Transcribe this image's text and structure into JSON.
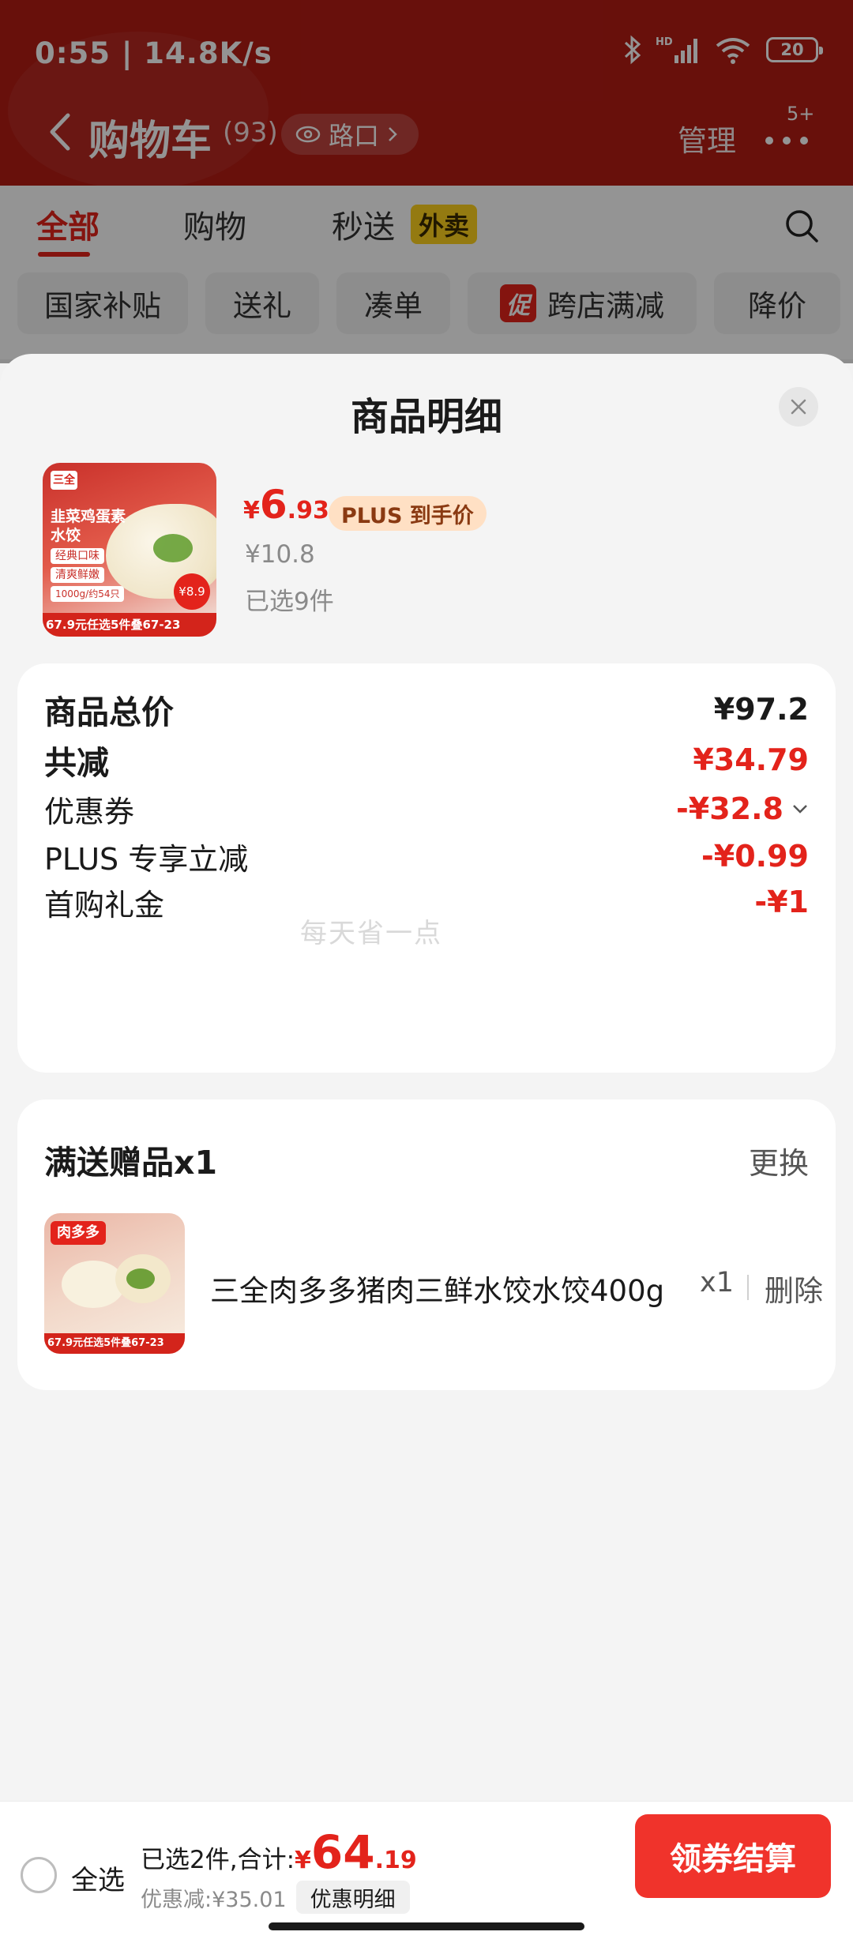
{
  "status_bar": {
    "time": "0:55 | 14.8K/s",
    "battery": "20",
    "network_badge": "HD",
    "icons": [
      "bluetooth-icon",
      "signal-icon",
      "wifi-icon",
      "battery-icon"
    ]
  },
  "header": {
    "title": "购物车",
    "count": "(93)",
    "location": "路口",
    "manage": "管理",
    "message_badge": "5+"
  },
  "tabs": [
    {
      "label": "全部",
      "active": true
    },
    {
      "label": "购物",
      "active": false
    },
    {
      "label": "秒送",
      "active": false
    }
  ],
  "tab_tag": "外卖",
  "filter_chips": [
    {
      "label": "国家补贴"
    },
    {
      "label": "送礼"
    },
    {
      "label": "凑单"
    },
    {
      "label": "跨店满减",
      "badge": "促"
    },
    {
      "label": "降价"
    }
  ],
  "sheet": {
    "title": "商品明细",
    "product": {
      "thumb": {
        "brand": "三全",
        "title": "韭菜鸡蛋素水饺",
        "tags": [
          "经典口味",
          "清爽鲜嫩",
          "1000g/约54只"
        ],
        "promo": "67.9元任选5件叠67-23",
        "price_badge": "¥8.9"
      },
      "price_symbol": "¥",
      "price_int": "6",
      "price_dec": ".93",
      "plus_label": "PLUS 到手价",
      "original_price": "¥10.8",
      "selected": "已选9件"
    },
    "breakdown": {
      "total_label": "商品总价",
      "total_value": "¥97.2",
      "saved_label": "共减",
      "saved_value": "¥34.79",
      "coupon_label": "优惠券",
      "coupon_value": "-¥32.8",
      "plus_label": "PLUS 专享立减",
      "plus_value": "-¥0.99",
      "gift_cash_label": "首购礼金",
      "gift_cash_value": "-¥1",
      "watermark": "每天省一点"
    },
    "gift": {
      "title": "满送赠品x1",
      "change": "更换",
      "thumb_brand": "肉多多",
      "thumb_promo": "67.9元任选5件叠67-23",
      "name": "三全肉多多猪肉三鲜水饺水饺400g",
      "qty": "x1",
      "delete": "删除"
    }
  },
  "bottom_bar": {
    "select_all": "全选",
    "summary_prefix": "已选2件,合计:",
    "total_symbol": "¥",
    "total_int": "64",
    "total_dec": ".19",
    "discount": "优惠减:¥35.01",
    "detail_button": "优惠明细",
    "checkout": "领券结算"
  },
  "colors": {
    "accent": "#e3231b",
    "header_bg": "#b31c14",
    "checkout_bg": "#f0332b",
    "plus_badge_bg": "#ffe0c4"
  }
}
